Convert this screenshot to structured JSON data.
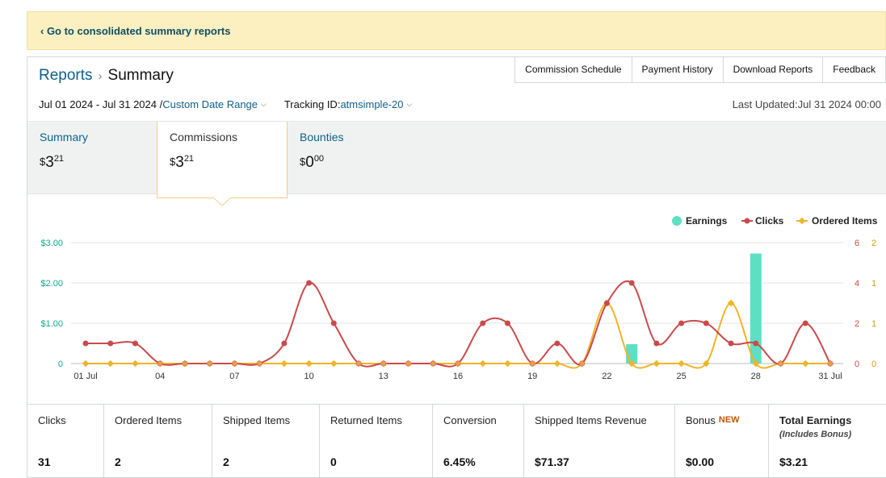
{
  "banner": {
    "link_text": "‹ Go to consolidated summary reports"
  },
  "breadcrumb": {
    "reports": "Reports",
    "separator": "›",
    "current": "Summary"
  },
  "top_tabs": [
    "Commission Schedule",
    "Payment History",
    "Download Reports",
    "Feedback"
  ],
  "filters": {
    "date_range": "Jul 01 2024 - Jul 31 2024 /",
    "date_range_link": "Custom Date Range",
    "tracking_label": "Tracking ID:",
    "tracking_id": "atmsimple-20"
  },
  "last_updated": "Last Updated:Jul 31 2024 00:00",
  "summary_tabs": [
    {
      "label": "Summary",
      "currency": "$",
      "whole": "3",
      "cents": "21"
    },
    {
      "label": "Commissions",
      "currency": "$",
      "whole": "3",
      "cents": "21"
    },
    {
      "label": "Bounties",
      "currency": "$",
      "whole": "0",
      "cents": "00"
    }
  ],
  "colors": {
    "earnings": "#5ddfc4",
    "clicks": "#c94a4a",
    "ordered": "#f0b429",
    "link": "#0f5f8a",
    "banner": "#fcefc0"
  },
  "chart_data": {
    "type": "line",
    "legend": [
      "Earnings",
      "Clicks",
      "Ordered Items"
    ],
    "legend_position": "top-right",
    "x_tick_labels": [
      "01 Jul",
      "04",
      "07",
      "10",
      "13",
      "16",
      "19",
      "22",
      "25",
      "28",
      "31 Jul"
    ],
    "left_axis": {
      "ticks": [
        "$3.00",
        "$2.00",
        "$1.00",
        "0"
      ],
      "range": [
        0,
        3
      ]
    },
    "right_axis_clicks": {
      "ticks": [
        "6",
        "4",
        "2",
        "0"
      ],
      "range": [
        0,
        6
      ]
    },
    "right_axis_ordered": {
      "ticks": [
        "2",
        "1",
        "1",
        "0"
      ],
      "range": [
        0,
        2
      ]
    },
    "days": [
      1,
      2,
      3,
      4,
      5,
      6,
      7,
      8,
      9,
      10,
      11,
      12,
      13,
      14,
      15,
      16,
      17,
      18,
      19,
      20,
      21,
      22,
      23,
      24,
      25,
      26,
      27,
      28,
      29,
      30,
      31
    ],
    "series": [
      {
        "name": "Earnings",
        "kind": "bar",
        "values": [
          0,
          0,
          0,
          0,
          0,
          0,
          0,
          0,
          0,
          0,
          0,
          0,
          0,
          0,
          0,
          0,
          0,
          0,
          0,
          0,
          0,
          0,
          0.48,
          0,
          0,
          0,
          0,
          2.73,
          0,
          0,
          0
        ]
      },
      {
        "name": "Clicks",
        "kind": "line",
        "values": [
          1,
          1,
          1,
          0,
          0,
          0,
          0,
          0,
          1,
          4,
          2,
          0,
          0,
          0,
          0,
          0,
          2,
          2,
          0,
          1,
          0,
          3,
          4,
          1,
          2,
          2,
          1,
          1,
          0,
          2,
          0
        ]
      },
      {
        "name": "Ordered Items",
        "kind": "line",
        "values": [
          0,
          0,
          0,
          0,
          0,
          0,
          0,
          0,
          0,
          0,
          0,
          0,
          0,
          0,
          0,
          0,
          0,
          0,
          0,
          0,
          0,
          1,
          0,
          0,
          0,
          0,
          1,
          0,
          0,
          0,
          0
        ]
      }
    ]
  },
  "metrics": [
    {
      "label": "Clicks",
      "value": "31"
    },
    {
      "label": "Ordered Items",
      "value": "2"
    },
    {
      "label": "Shipped Items",
      "value": "2"
    },
    {
      "label": "Returned Items",
      "value": "0"
    },
    {
      "label": "Conversion",
      "value": "6.45%"
    },
    {
      "label": "Shipped Items Revenue",
      "value": "$71.37"
    },
    {
      "label": "Bonus",
      "badge": "NEW",
      "value": "$0.00"
    },
    {
      "label": "Total Earnings",
      "sub": "(Includes Bonus)",
      "value": "$3.21"
    }
  ]
}
